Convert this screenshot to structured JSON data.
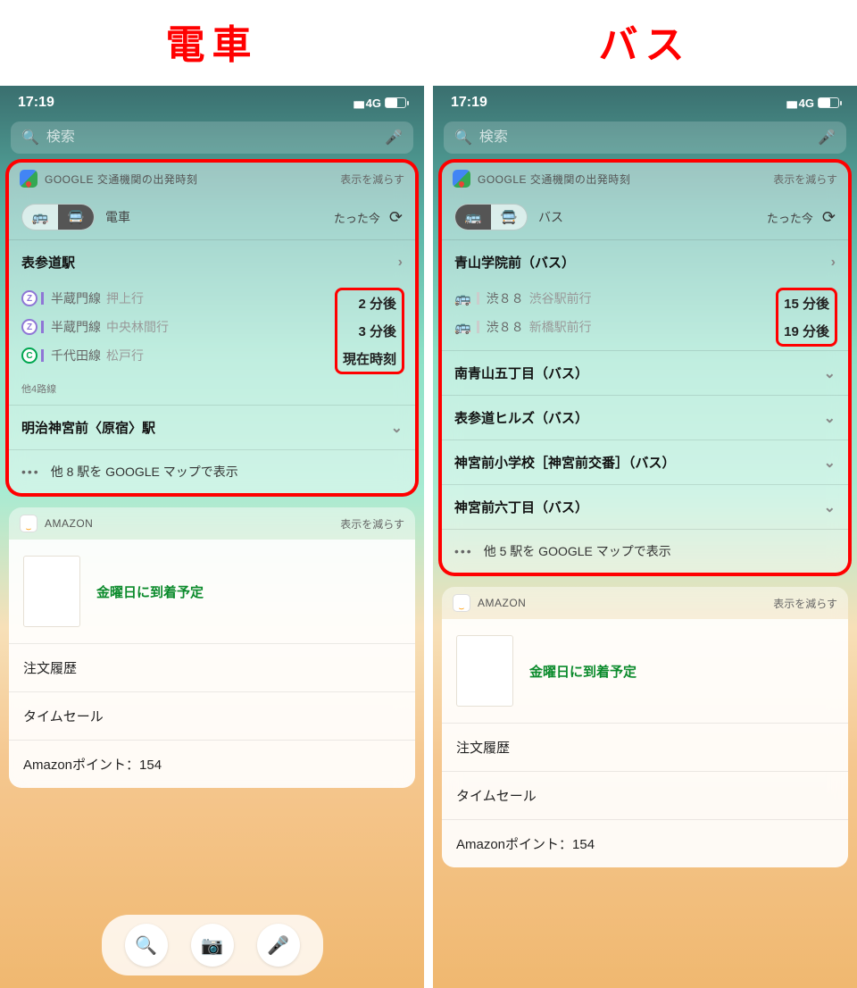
{
  "headings": {
    "left": "電車",
    "right": "バス"
  },
  "status": {
    "time": "17:19",
    "network": "4G"
  },
  "search": {
    "placeholder": "検索"
  },
  "gmaps": {
    "title": "GOOGLE 交通機関の出発時刻",
    "collapse": "表示を減らす",
    "updated": "たった今",
    "mode_train": "電車",
    "mode_bus": "バス"
  },
  "left": {
    "station": "表参道駅",
    "lines": [
      {
        "badge": "Z",
        "cls": "z",
        "name": "半蔵門線",
        "dest": "押上行",
        "eta": "2 分後"
      },
      {
        "badge": "Z",
        "cls": "z",
        "name": "半蔵門線",
        "dest": "中央林間行",
        "eta": "3 分後"
      },
      {
        "badge": "C",
        "cls": "c",
        "name": "千代田線",
        "dest": "松戸行",
        "eta": "現在時刻"
      }
    ],
    "other_lines": "他4路線",
    "next_station": "明治神宮前〈原宿〉駅",
    "more": "他 8 駅を GOOGLE マップで表示"
  },
  "right": {
    "station": "青山学院前（バス）",
    "lines": [
      {
        "badge": "🚌",
        "name": "渋８８",
        "dest": "渋谷駅前行",
        "eta": "15 分後"
      },
      {
        "badge": "🚌",
        "name": "渋８８",
        "dest": "新橋駅前行",
        "eta": "19 分後"
      }
    ],
    "stops": [
      "南青山五丁目（バス）",
      "表参道ヒルズ（バス）",
      "神宮前小学校［神宮前交番］（バス）",
      "神宮前六丁目（バス）"
    ],
    "more": "他 5 駅を GOOGLE マップで表示"
  },
  "amazon": {
    "title": "AMAZON",
    "collapse": "表示を減らす",
    "delivery": "金曜日に到着予定",
    "items": [
      "注文履歴",
      "タイムセール",
      "Amazonポイント：154"
    ]
  }
}
